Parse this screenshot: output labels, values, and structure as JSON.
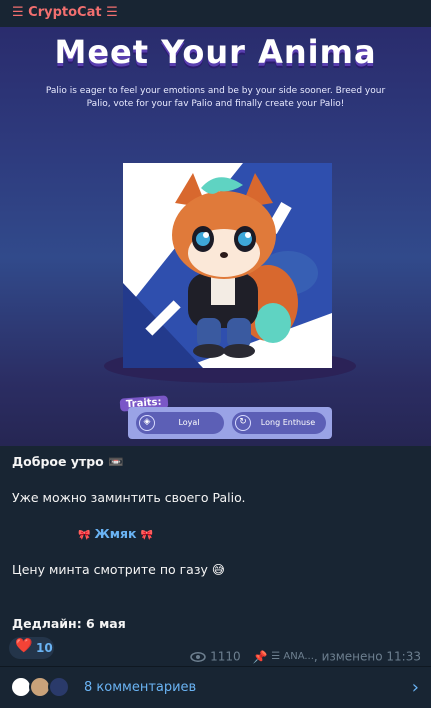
{
  "channel": {
    "name": "☰ CryptoCat ☰"
  },
  "banner": {
    "title": "Meet Your Anima",
    "subtitle": "Palio is eager to feel your emotions and be by your side sooner. Breed your Palio, vote for your fav Palio and finally create your Palio!",
    "traits_label": "Traits:",
    "traits": [
      {
        "name": "Loyal",
        "icon": "shield-icon"
      },
      {
        "name": "Long Enthuse",
        "icon": "swirl-icon"
      }
    ]
  },
  "message": {
    "greeting": "Доброе утро 📼",
    "line1": "Уже можно заминтить своего Palio.",
    "link_prefix": "🎀",
    "link_text": "Жмяк",
    "link_suffix": "🎀",
    "line2": "Цену минта смотрите по газу 😅",
    "deadline": "Дедлайн: 6 мая"
  },
  "reaction": {
    "emoji": "❤️",
    "count": "10"
  },
  "meta": {
    "views": "1110",
    "author": "☰ ANA...",
    "edited": "изменено 11:33"
  },
  "comments": {
    "label": "8 комментариев"
  },
  "colors": {
    "accent": "#6ab3f3",
    "channel": "#f26f6f",
    "background": "#182533"
  }
}
